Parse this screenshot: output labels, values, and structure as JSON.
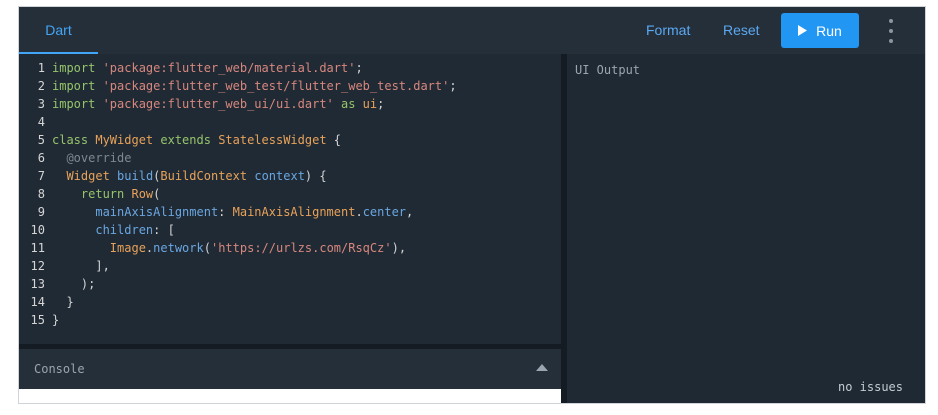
{
  "tabs": [
    {
      "label": "Dart"
    }
  ],
  "toolbar": {
    "format_label": "Format",
    "reset_label": "Reset",
    "run_label": "Run",
    "menu_icon": "more-vert-icon",
    "run_icon": "play-icon"
  },
  "editor": {
    "lines": [
      {
        "n": "1",
        "tokens": [
          {
            "t": "import ",
            "c": "kw"
          },
          {
            "t": "'package:flutter_web/material.dart'",
            "c": "str"
          },
          {
            "t": ";",
            "c": "punc"
          }
        ]
      },
      {
        "n": "2",
        "tokens": [
          {
            "t": "import ",
            "c": "kw"
          },
          {
            "t": "'package:flutter_web_test/flutter_web_test.dart'",
            "c": "str"
          },
          {
            "t": ";",
            "c": "punc"
          }
        ]
      },
      {
        "n": "3",
        "tokens": [
          {
            "t": "import ",
            "c": "kw"
          },
          {
            "t": "'package:flutter_web_ui/ui.dart'",
            "c": "str"
          },
          {
            "t": " as ",
            "c": "kw"
          },
          {
            "t": "ui",
            "c": "cls"
          },
          {
            "t": ";",
            "c": "punc"
          }
        ]
      },
      {
        "n": "4",
        "tokens": []
      },
      {
        "n": "5",
        "tokens": [
          {
            "t": "class ",
            "c": "kw"
          },
          {
            "t": "MyWidget",
            "c": "cls"
          },
          {
            "t": " extends ",
            "c": "kw"
          },
          {
            "t": "StatelessWidget",
            "c": "cls"
          },
          {
            "t": " {",
            "c": "punc"
          }
        ]
      },
      {
        "n": "6",
        "tokens": [
          {
            "t": "  @override",
            "c": "ann"
          }
        ]
      },
      {
        "n": "7",
        "tokens": [
          {
            "t": "  ",
            "c": "punc"
          },
          {
            "t": "Widget",
            "c": "cls"
          },
          {
            "t": " ",
            "c": "punc"
          },
          {
            "t": "build",
            "c": "fn"
          },
          {
            "t": "(",
            "c": "punc"
          },
          {
            "t": "BuildContext",
            "c": "cls"
          },
          {
            "t": " ",
            "c": "punc"
          },
          {
            "t": "context",
            "c": "prop"
          },
          {
            "t": ") {",
            "c": "punc"
          }
        ]
      },
      {
        "n": "8",
        "tokens": [
          {
            "t": "    return ",
            "c": "kw"
          },
          {
            "t": "Row",
            "c": "cls"
          },
          {
            "t": "(",
            "c": "punc"
          }
        ]
      },
      {
        "n": "9",
        "tokens": [
          {
            "t": "      mainAxisAlignment",
            "c": "prop"
          },
          {
            "t": ": ",
            "c": "punc"
          },
          {
            "t": "MainAxisAlignment",
            "c": "cls"
          },
          {
            "t": ".",
            "c": "punc"
          },
          {
            "t": "center",
            "c": "prop"
          },
          {
            "t": ",",
            "c": "punc"
          }
        ]
      },
      {
        "n": "10",
        "tokens": [
          {
            "t": "      children",
            "c": "prop"
          },
          {
            "t": ": [",
            "c": "punc"
          }
        ]
      },
      {
        "n": "11",
        "tokens": [
          {
            "t": "        ",
            "c": "punc"
          },
          {
            "t": "Image",
            "c": "cls"
          },
          {
            "t": ".",
            "c": "punc"
          },
          {
            "t": "network",
            "c": "fn"
          },
          {
            "t": "(",
            "c": "punc"
          },
          {
            "t": "'https://urlzs.com/RsqCz'",
            "c": "str"
          },
          {
            "t": "),",
            "c": "punc"
          }
        ]
      },
      {
        "n": "12",
        "tokens": [
          {
            "t": "      ],",
            "c": "punc"
          }
        ]
      },
      {
        "n": "13",
        "tokens": [
          {
            "t": "    );",
            "c": "punc"
          }
        ]
      },
      {
        "n": "14",
        "tokens": [
          {
            "t": "  }",
            "c": "punc"
          }
        ]
      },
      {
        "n": "15",
        "tokens": [
          {
            "t": "}",
            "c": "punc"
          }
        ]
      }
    ]
  },
  "console": {
    "title": "Console",
    "toggle_icon": "caret-up-icon"
  },
  "output": {
    "label": "UI Output",
    "status": "no issues"
  }
}
